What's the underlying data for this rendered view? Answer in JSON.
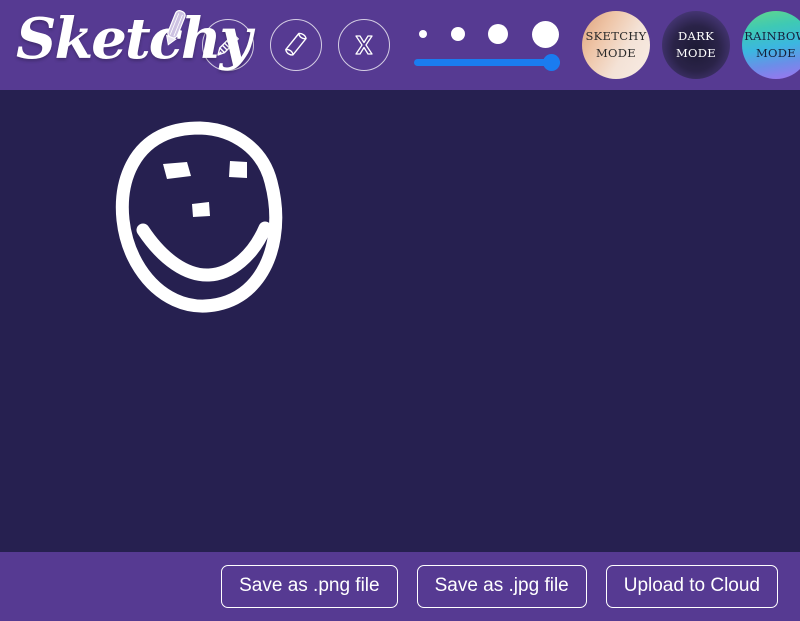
{
  "app": {
    "title": "Sketchy",
    "logo_icon": "pencil-icon"
  },
  "colors": {
    "topbar": "#563a92",
    "bottombar": "#563a92",
    "canvas": "#262050",
    "slider": "#1a7cf0",
    "stroke": "#ffffff"
  },
  "toolbar": {
    "tools": [
      {
        "name": "pencil",
        "icon": "pencil-icon",
        "label": "Pencil"
      },
      {
        "name": "eraser",
        "icon": "eraser-icon",
        "label": "Eraser"
      },
      {
        "name": "clear",
        "icon": "x-icon",
        "label": "X"
      }
    ],
    "brush": {
      "sizes": [
        1,
        2,
        3,
        4
      ],
      "slider_value": 100,
      "slider_min": 0,
      "slider_max": 100
    },
    "modes": [
      {
        "id": "sketchy",
        "line1": "SKETCHY",
        "line2": "MODE"
      },
      {
        "id": "dark",
        "line1": "DARK",
        "line2": "MODE"
      },
      {
        "id": "rainbow",
        "line1": "RAINBOW",
        "line2": "MODE"
      }
    ]
  },
  "canvas": {
    "drawing": "hand-drawn smiley face"
  },
  "footer": {
    "buttons": [
      {
        "id": "save-png",
        "label": "Save as .png file"
      },
      {
        "id": "save-jpg",
        "label": "Save as .jpg file"
      },
      {
        "id": "upload-cloud",
        "label": "Upload to Cloud"
      }
    ]
  }
}
